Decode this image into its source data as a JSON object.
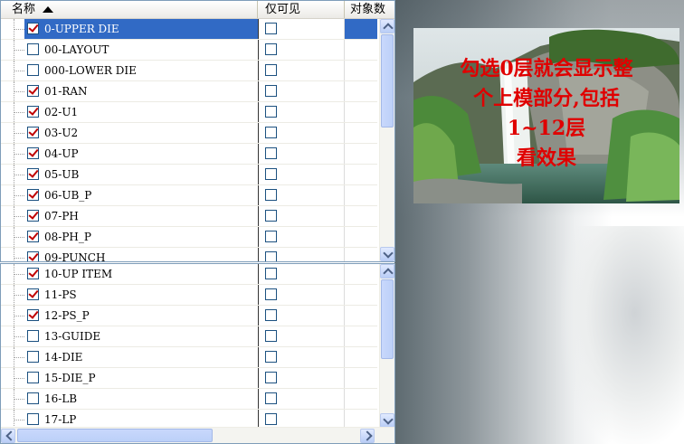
{
  "columns": {
    "name": "名称",
    "visible_only": "仅可见",
    "object_count": "对象数"
  },
  "top_panel": {
    "rows": [
      {
        "label": "0-UPPER DIE",
        "checked": true,
        "visible_only": false,
        "selected": true
      },
      {
        "label": "00-LAYOUT",
        "checked": false,
        "visible_only": false
      },
      {
        "label": "000-LOWER DIE",
        "checked": false,
        "visible_only": false
      },
      {
        "label": "01-RAN",
        "checked": true,
        "visible_only": false
      },
      {
        "label": "02-U1",
        "checked": true,
        "visible_only": false
      },
      {
        "label": "03-U2",
        "checked": true,
        "visible_only": false
      },
      {
        "label": "04-UP",
        "checked": true,
        "visible_only": false
      },
      {
        "label": "05-UB",
        "checked": true,
        "visible_only": false
      },
      {
        "label": "06-UB_P",
        "checked": true,
        "visible_only": false
      },
      {
        "label": "07-PH",
        "checked": true,
        "visible_only": false
      },
      {
        "label": "08-PH_P",
        "checked": true,
        "visible_only": false
      },
      {
        "label": "09-PUNCH",
        "checked": true,
        "visible_only": false
      }
    ]
  },
  "bottom_panel": {
    "rows": [
      {
        "label": "10-UP ITEM",
        "checked": true,
        "visible_only": false
      },
      {
        "label": "11-PS",
        "checked": true,
        "visible_only": false
      },
      {
        "label": "12-PS_P",
        "checked": true,
        "visible_only": false
      },
      {
        "label": "13-GUIDE",
        "checked": false,
        "visible_only": false
      },
      {
        "label": "14-DIE",
        "checked": false,
        "visible_only": false
      },
      {
        "label": "15-DIE_P",
        "checked": false,
        "visible_only": false
      },
      {
        "label": "16-LB",
        "checked": false,
        "visible_only": false
      },
      {
        "label": "17-LP",
        "checked": false,
        "visible_only": false
      }
    ]
  },
  "caption": "勾选0层就会显示整\n个上模部分,包括\n1~12层\n看效果",
  "colors": {
    "selection": "#316ac5",
    "checkmark": "#c00000",
    "caption": "#e00000"
  }
}
